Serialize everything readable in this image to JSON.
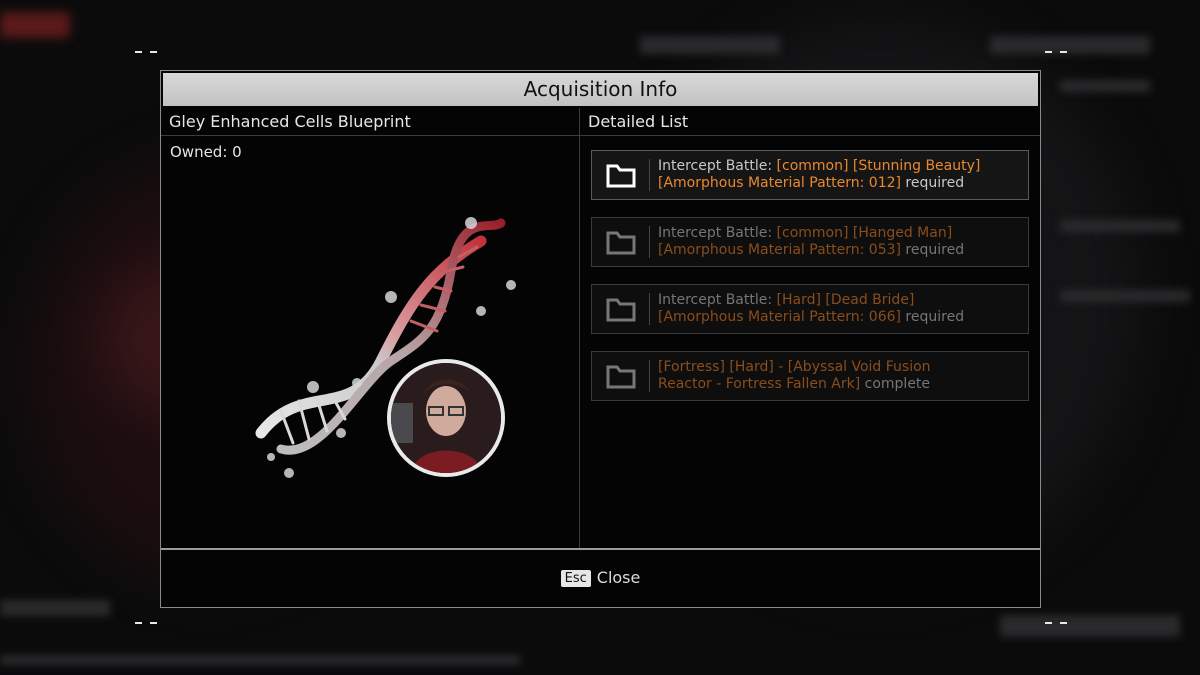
{
  "dialog": {
    "title": "Acquisition Info",
    "left_header": "Gley Enhanced Cells Blueprint",
    "right_header": "Detailed List",
    "owned_label": "Owned: 0"
  },
  "entries": [
    {
      "state": "active",
      "line1_plain": "Intercept Battle: ",
      "line1_hl": "[common] [Stunning Beauty]",
      "line2_hl": "[Amorphous Material Pattern: 012]",
      "line2_plain": " required",
      "icon": "folder-icon"
    },
    {
      "state": "dim",
      "line1_plain": "Intercept Battle: ",
      "line1_hl": "[common] [Hanged Man]",
      "line2_hl": "[Amorphous Material Pattern: 053]",
      "line2_plain": " required",
      "icon": "folder-icon"
    },
    {
      "state": "dim",
      "line1_plain": "Intercept Battle: ",
      "line1_hl": "[Hard] [Dead Bride]",
      "line2_hl": "[Amorphous Material Pattern: 066]",
      "line2_plain": " required",
      "icon": "folder-icon"
    },
    {
      "state": "dim",
      "line1_plain": "",
      "line1_hl": "[Fortress] [Hard] - [Abyssal Void Fusion",
      "line2_hl": "Reactor - Fortress Fallen Ark]",
      "line2_plain": " complete",
      "icon": "folder-icon"
    }
  ],
  "footer": {
    "key": "Esc",
    "label": "Close"
  },
  "colors": {
    "highlight": "#e8892e",
    "title_bar": "#cfcfcf",
    "background": "#040404"
  }
}
